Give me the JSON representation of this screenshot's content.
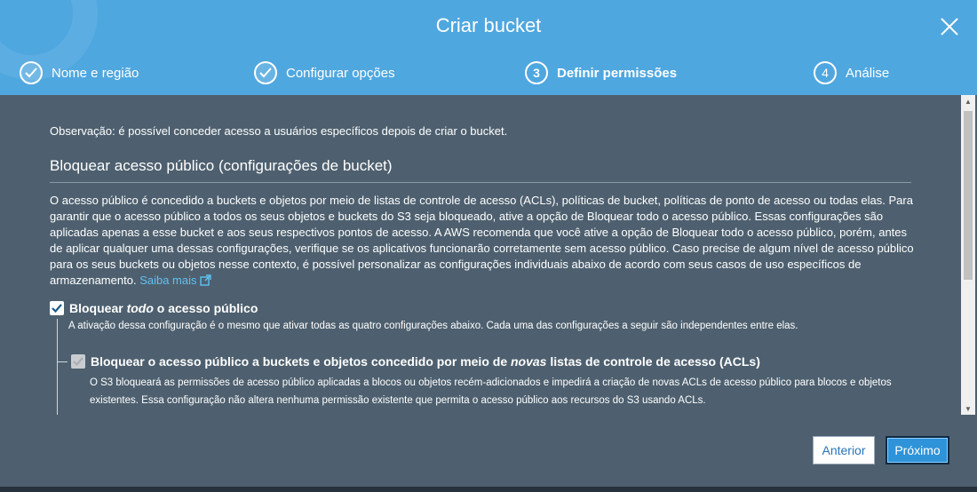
{
  "dialog": {
    "title": "Criar bucket"
  },
  "steps": [
    {
      "number": "",
      "label": "Nome e região",
      "state": "done"
    },
    {
      "number": "",
      "label": "Configurar opções",
      "state": "done"
    },
    {
      "number": "3",
      "label": "Definir permissões",
      "state": "active"
    },
    {
      "number": "4",
      "label": "Análise",
      "state": "pending"
    }
  ],
  "content": {
    "note": "Observação: é possível conceder acesso a usuários específicos depois de criar o bucket.",
    "section_title": "Bloquear acesso público (configurações de bucket)",
    "description": "O acesso público é concedido a buckets e objetos por meio de listas de controle de acesso (ACLs), políticas de bucket, políticas de ponto de acesso ou todas elas. Para garantir que o acesso público a todos os seus objetos e buckets do S3 seja bloqueado, ative a opção de Bloquear todo o acesso público. Essas configurações são aplicadas apenas a esse bucket e aos seus respectivos pontos de acesso. A AWS recomenda que você ative a opção de Bloquear todo o acesso público, porém, antes de aplicar qualquer uma dessas configurações, verifique se os aplicativos funcionarão corretamente sem acesso público. Caso precise de algum nível de acesso público para os seus buckets ou objetos nesse contexto, é possível personalizar as configurações individuais abaixo de acordo com seus casos de uso específicos de armazenamento.",
    "learn_more": "Saiba mais",
    "block_all": {
      "label_pre": "Bloquear ",
      "label_em": "todo",
      "label_post": " o acesso público",
      "checked": true,
      "help": "A ativação dessa configuração é o mesmo que ativar todas as quatro configurações abaixo. Cada uma das configurações a seguir são independentes entre elas."
    },
    "block_new_acls": {
      "label_pre": "Bloquear o acesso público a buckets e objetos concedido por meio de ",
      "label_em": "novas",
      "label_post": " listas de controle de acesso (ACLs)",
      "checked": true,
      "disabled": true,
      "help": "O S3 bloqueará as permissões de acesso público aplicadas a blocos ou objetos recém-adicionados e impedirá a criação de novas ACLs de acesso público para blocos e objetos existentes. Essa configuração não altera nenhuma permissão existente que permita o acesso público aos recursos do S3 usando ACLs."
    }
  },
  "footer": {
    "prev_label": "Anterior",
    "next_label": "Próximo"
  },
  "colors": {
    "header": "#4fa7df",
    "body": "#4e606f",
    "link": "#5fc1f3",
    "primary": "#2f93d9"
  }
}
